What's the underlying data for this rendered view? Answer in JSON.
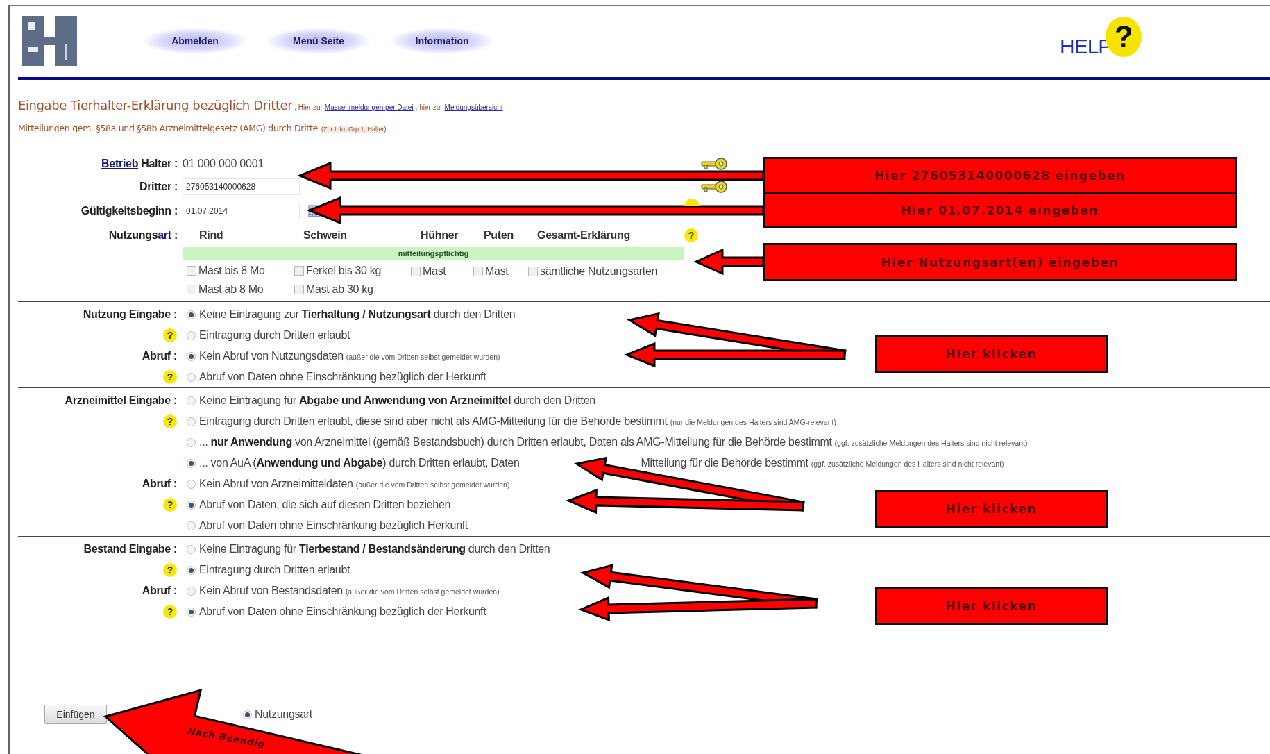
{
  "header": {
    "nav": [
      {
        "label": "Abmelden"
      },
      {
        "label": "Menü Seite"
      },
      {
        "label": "Information"
      }
    ],
    "help_logo": {
      "text": "HELP",
      "mark": "?"
    }
  },
  "title": {
    "heading": "Eingabe Tierhalter-Erklärung bezüglich Dritter",
    "links": [
      {
        "prefix": ", Hier zur",
        "label": "Massenmeldungen per Datei"
      },
      {
        "prefix": ", hier zur",
        "label": "Meldungsübersicht"
      }
    ],
    "subtitle": "Mitteilungen gem. §58a und §58b Arzneimittelgesetz (AMG) durch Dritte",
    "note": "(Zur Info: Grp.1, Halter)"
  },
  "fields": [
    {
      "kind": "text",
      "label_link": "Betrieb",
      "label": "Halter :",
      "value": "01 000 000 0001"
    },
    {
      "kind": "input",
      "label": "Dritter :",
      "value": "276053140000628"
    },
    {
      "kind": "date",
      "label": "Gültigkeitsbeginn :",
      "value": "01.07.2014"
    }
  ],
  "nutzungsart": {
    "label": "Nutzungs",
    "label_link": "art",
    "label_suffix": ":",
    "help": "?",
    "band": "mitteilungspflichtig",
    "columns": [
      {
        "heading": "Rind",
        "options": [
          {
            "label": "Mast bis 8 Mo",
            "checked": false
          },
          {
            "label": "Mast ab 8 Mo",
            "checked": false
          }
        ]
      },
      {
        "heading": "Schwein",
        "options": [
          {
            "label": "Ferkel bis 30 kg",
            "checked": false
          },
          {
            "label": "Mast ab 30 kg",
            "checked": false
          }
        ]
      },
      {
        "heading": "Hühner",
        "options": [
          {
            "label": "Mast",
            "checked": false
          }
        ]
      },
      {
        "heading": "Puten",
        "options": [
          {
            "label": "Mast",
            "checked": false
          }
        ]
      },
      {
        "heading": "Gesamt-Erklärung",
        "options": [
          {
            "label": "sämtliche Nutzungsarten",
            "checked": false
          }
        ]
      }
    ]
  },
  "sections": [
    {
      "groups": [
        {
          "label": "Nutzung Eingabe :",
          "options": [
            {
              "selected": true,
              "text": "Keine Eintragung zur **Tierhaltung / Nutzungsart** durch den Dritten"
            },
            {
              "help": "?",
              "selected": false,
              "text": "Eintragung durch Dritten erlaubt"
            }
          ]
        },
        {
          "label": "Abruf :",
          "options": [
            {
              "selected": true,
              "text": "Kein Abruf von Nutzungsdaten",
              "note": "(außer die vom Dritten selbst gemeldet wurden)"
            },
            {
              "help": "?",
              "selected": false,
              "text": "Abruf von Daten ohne Einschränkung bezüglich der Herkunft"
            }
          ]
        }
      ]
    },
    {
      "groups": [
        {
          "label": "Arzneimittel Eingabe :",
          "options": [
            {
              "selected": false,
              "text": "Keine Eintragung für **Abgabe und Anwendung von Arzneimittel** durch den Dritten"
            },
            {
              "help": "?",
              "selected": false,
              "text": "Eintragung durch Dritten erlaubt, diese sind aber nicht als AMG-Mitteilung für die Behörde bestimmt",
              "note": "(nur die Meldungen des Halters sind AMG-relevant)"
            },
            {
              "selected": false,
              "text": "... **nur Anwendung** von Arzneimittel (gemäß Bestandsbuch) durch Dritten erlaubt, Daten als AMG-Mitteilung für die Behörde bestimmt",
              "note": "(ggf. zusätzliche Meldungen des Halters sind nicht relevant)"
            },
            {
              "selected": true,
              "text": "... von AuA (**Anwendung und Abgabe**) durch Dritten erlaubt, Daten",
              "text_after": "Mitteilung für die Behörde bestimmt",
              "note": "(ggf. zusätzliche Meldungen des Halters sind nicht relevant)"
            }
          ]
        },
        {
          "label": "Abruf :",
          "options": [
            {
              "selected": false,
              "text": "Kein Abruf von Arzneimitteldaten",
              "note": "(außer die vom Dritten selbst gemeldet wurden)"
            },
            {
              "help": "?",
              "selected": true,
              "text": "Abruf von Daten, die sich auf diesen Dritten beziehen"
            },
            {
              "selected": false,
              "text": "Abruf von Daten ohne Einschränkung bezüglich Herkunft"
            }
          ]
        }
      ]
    },
    {
      "groups": [
        {
          "label": "Bestand Eingabe :",
          "options": [
            {
              "selected": false,
              "text": "Keine Eintragung für **Tierbestand / Bestandsänderung** durch den Dritten"
            },
            {
              "help": "?",
              "selected": true,
              "text": "Eintragung durch Dritten erlaubt"
            }
          ]
        },
        {
          "label": "Abruf :",
          "options": [
            {
              "selected": false,
              "text": "Kein Abruf von Bestandsdaten",
              "note": "(außer die vom Dritten selbst gemeldet wurden)"
            },
            {
              "help": "?",
              "selected": true,
              "text": "Abruf von Daten ohne Einschränkung bezüglich der Herkunft"
            }
          ]
        }
      ]
    }
  ],
  "footer": {
    "button": "Einfügen",
    "option": {
      "label": "Nutzungsart",
      "selected": true
    }
  },
  "callouts": [
    {
      "kind": "box",
      "text": "Hier 276053140000628 eingeben"
    },
    {
      "kind": "box",
      "text": "Hier 01.07.2014 eingeben"
    },
    {
      "kind": "box",
      "text": "Hier Nutzungsart(en) eingeben"
    },
    {
      "kind": "box",
      "text": "Hier klicken"
    },
    {
      "kind": "box",
      "text": "Hier klicken"
    },
    {
      "kind": "box",
      "text": "Hier klicken"
    },
    {
      "kind": "arrow_label",
      "text": "Nach Beendig"
    }
  ]
}
